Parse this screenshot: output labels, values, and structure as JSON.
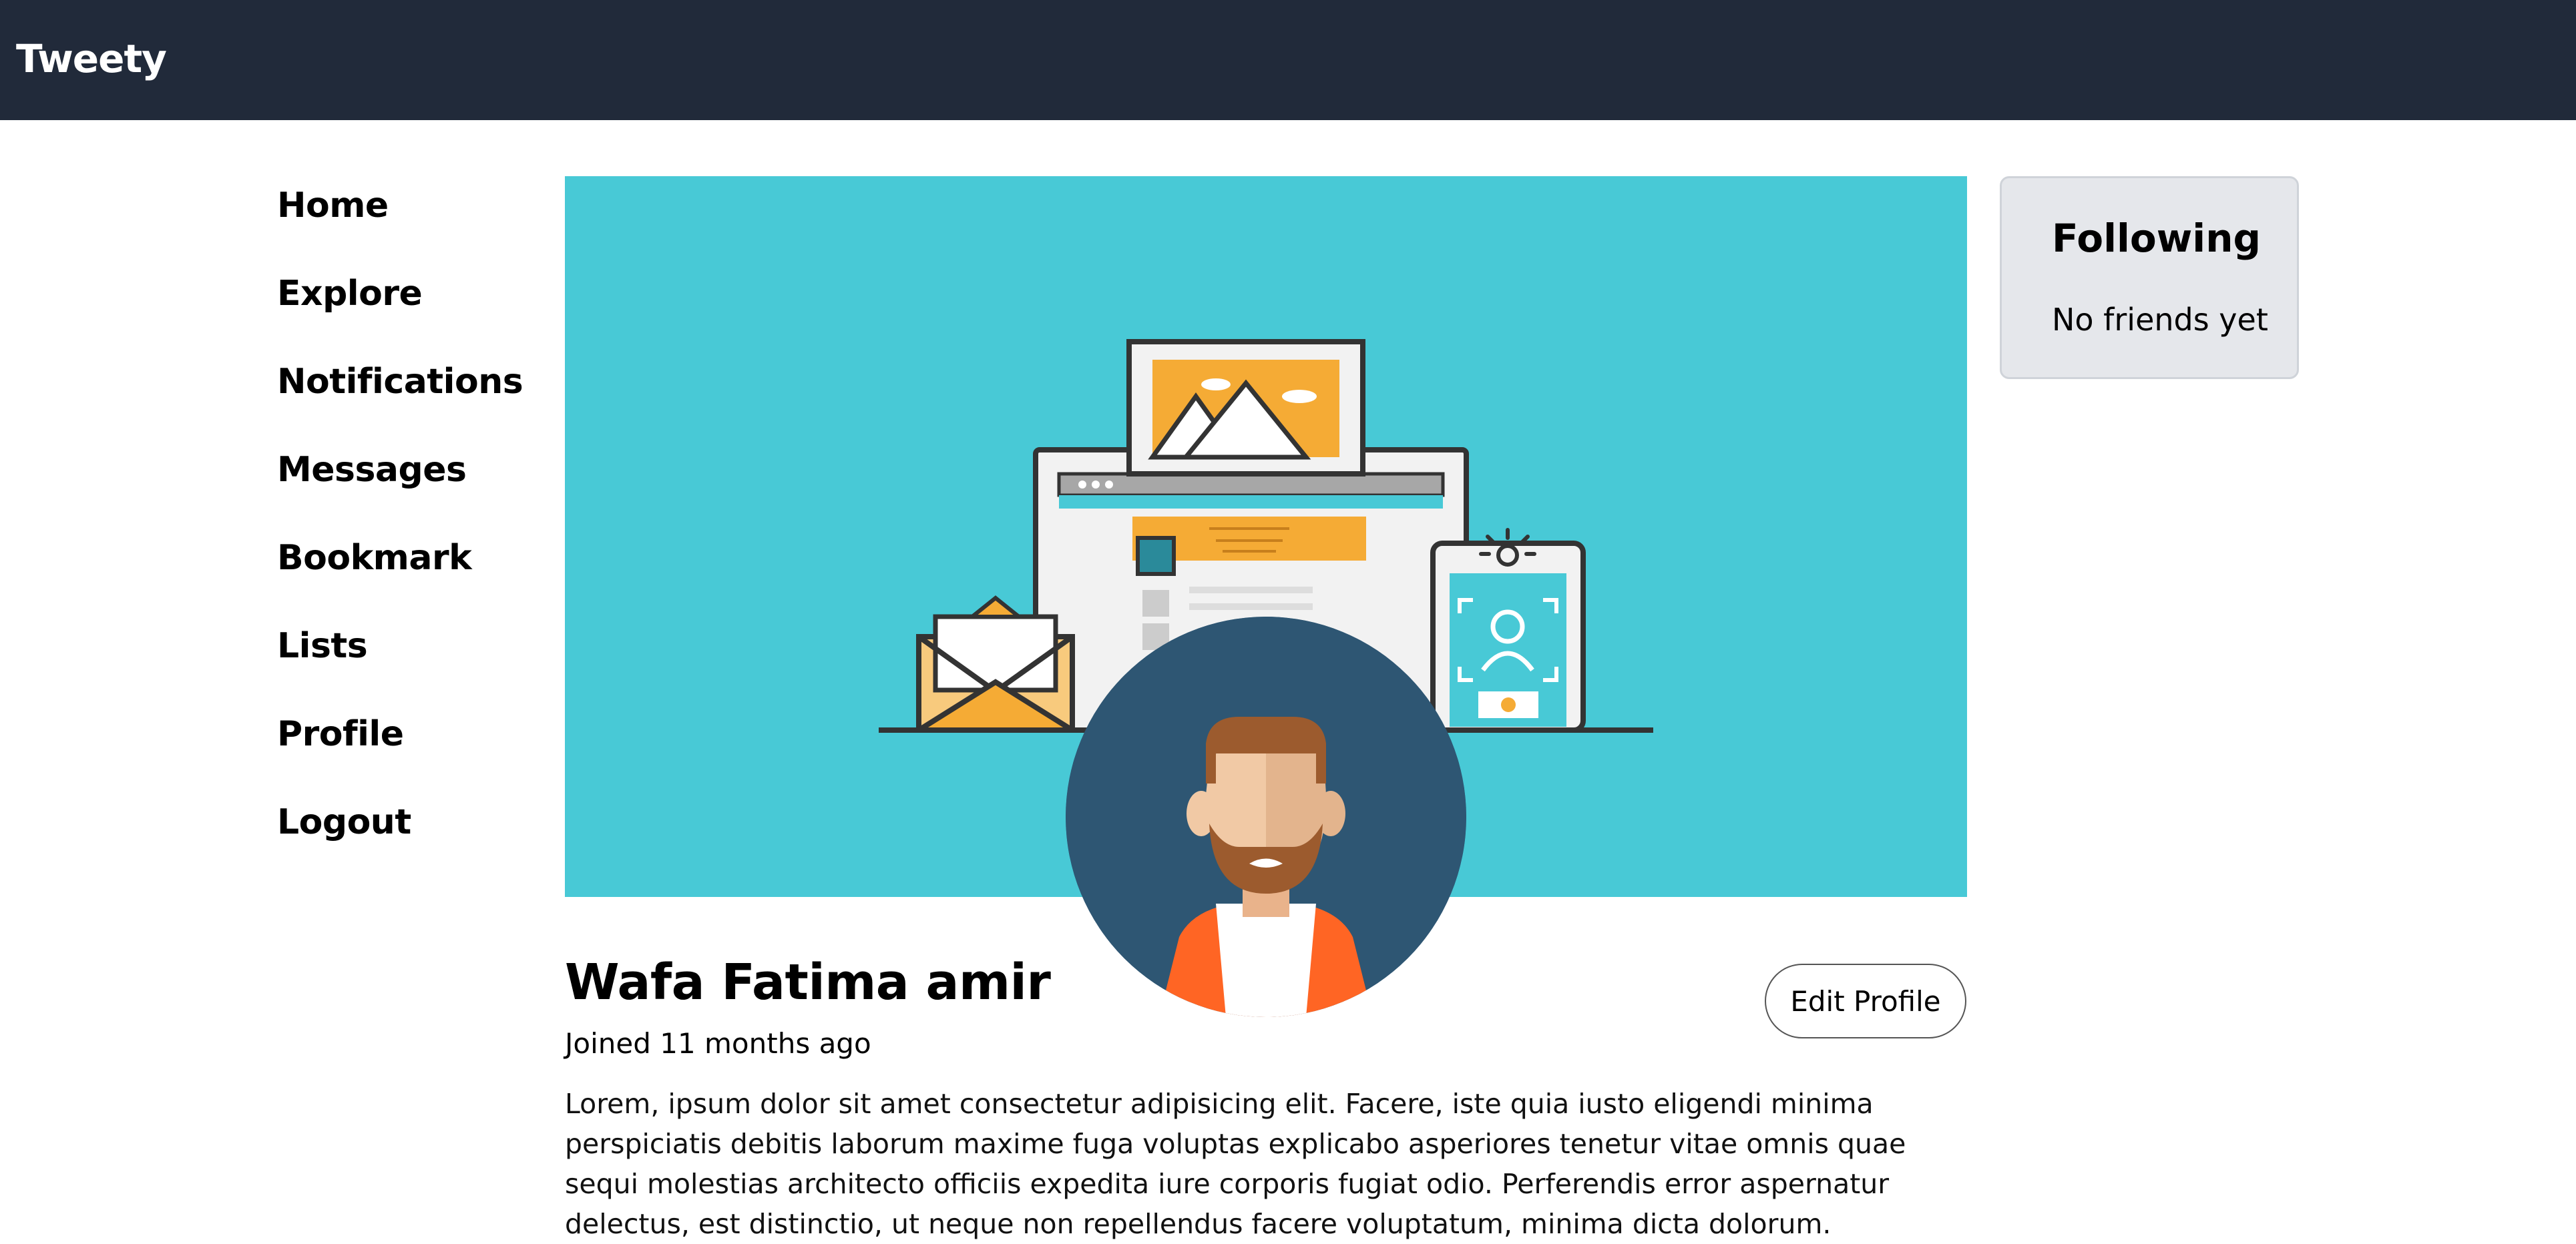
{
  "app": {
    "brand": "Tweety"
  },
  "sidebar": {
    "items": [
      {
        "label": "Home"
      },
      {
        "label": "Explore"
      },
      {
        "label": "Notifications"
      },
      {
        "label": "Messages"
      },
      {
        "label": "Bookmark"
      },
      {
        "label": "Lists"
      },
      {
        "label": "Profile"
      },
      {
        "label": "Logout"
      }
    ]
  },
  "profile": {
    "name": "Wafa Fatima amir",
    "joined": "Joined 11 months ago",
    "edit_label": "Edit Profile",
    "bio": "Lorem, ipsum dolor sit amet consectetur adipisicing elit. Facere, iste quia iusto eligendi minima perspiciatis debitis laborum maxime fuga voluptas explicabo asperiores tenetur vitae omnis quae sequi molestias architecto officiis expedita iure corporis fugiat odio. Perferendis error aspernatur delectus, est distinctio, ut neque non repellendus facere voluptatum, minima dicta dolorum."
  },
  "following": {
    "title": "Following",
    "empty_text": "No friends yet"
  },
  "colors": {
    "topbar": "#212a3a",
    "banner": "#48c9d6",
    "avatar_bg": "#2e5673",
    "accent_orange": "#f5ab35",
    "shirt_orange": "#ff6524"
  }
}
